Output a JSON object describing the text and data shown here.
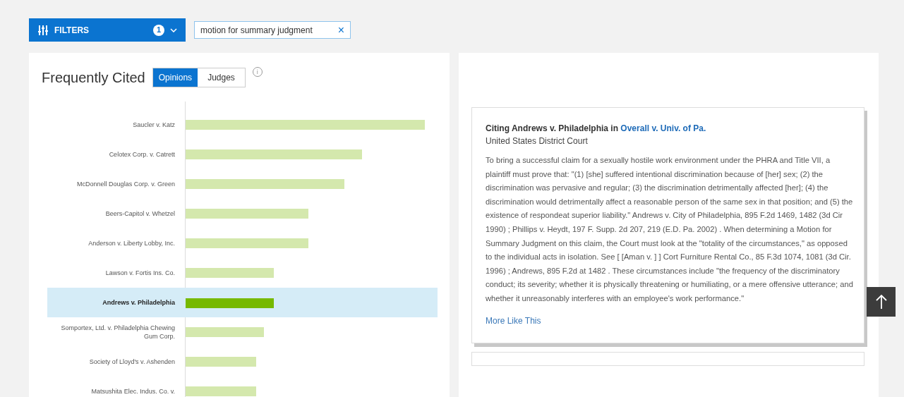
{
  "filters_button": {
    "label": "FILTERS",
    "count": "1"
  },
  "search_chip": {
    "text": "motion for summary judgment",
    "remove": "×"
  },
  "frequently_cited": {
    "title": "Frequently Cited",
    "tabs": [
      {
        "label": "Opinions",
        "selected": true
      },
      {
        "label": "Judges",
        "selected": false
      }
    ],
    "info": "i",
    "cases": [
      {
        "name": "Saucler v. Katz",
        "selected": false
      },
      {
        "name": "Celotex Corp. v. Catrett",
        "selected": false
      },
      {
        "name": "McDonnell Douglas Corp. v. Green",
        "selected": false
      },
      {
        "name": "Beers-Capitol v. Whetzel",
        "selected": false
      },
      {
        "name": "Anderson v. Liberty Lobby, Inc.",
        "selected": false
      },
      {
        "name": "Lawson v. Fortis Ins. Co.",
        "selected": false
      },
      {
        "name": "Andrews v. Philadelphia",
        "selected": true
      },
      {
        "name": "Somportex, Ltd. v. Philadelphia Chewing Gum Corp.",
        "selected": false
      },
      {
        "name": "Society of Lloyd's v. Ashenden",
        "selected": false
      },
      {
        "name": "Matsushita Elec. Indus. Co. v.",
        "selected": false
      }
    ]
  },
  "citation_card": {
    "title_prefix": "Citing Andrews v. Philadelphia in",
    "title_link": "Overall v. Univ. of Pa.",
    "court": "United States District Court",
    "excerpt": "To bring a successful claim for a sexually hostile work environment under the PHRA and Title VII, a plaintiff must prove that: \"(1) [she] suffered intentional discrimination because of [her] sex; (2) the discrimination was pervasive and regular; (3) the discrimination detrimentally affected [her]; (4) the discrimination would detrimentally affect a reasonable person of the same sex in that position; and (5) the existence of respondeat superior liability.\" Andrews v. City of Philadelphia, 895 F.2d 1469, 1482 (3d Cir 1990) ; Phillips v. Heydt, 197 F. Supp. 2d 207, 219 (E.D. Pa. 2002) . When determining a Motion for Summary Judgment on this claim, the Court must look at the \"totality of the circumstances,\" as opposed to the individual acts in isolation. See [ [Aman v. ] ] Cort Furniture Rental Co., 85 F.3d 1074, 1081 (3d Cir. 1996) ; Andrews, 895 F.2d at 1482 . These circumstances include \"the frequency of the discriminatory conduct; its severity; whether it is physically threatening or humiliating, or a mere offensive utterance; and whether it unreasonably interferes with an employee's work performance.\"",
    "more_link": "More Like This"
  }
}
